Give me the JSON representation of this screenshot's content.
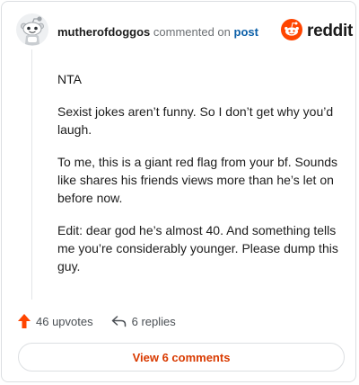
{
  "colors": {
    "reddit_orange": "#ff4500",
    "link_blue": "#0b5fa8",
    "button_text": "#d93a00"
  },
  "header": {
    "username": "mutherofdoggos",
    "action_text": "commented on",
    "post_link": "post",
    "logo_text": "reddit",
    "avatar_icon": "snoo-avatar-icon",
    "logo_icon": "reddit-alien-icon"
  },
  "comment": {
    "paragraphs": [
      "NTA",
      "Sexist jokes aren’t funny. So I don’t get why you’d laugh.",
      "To me, this is a giant red flag from your bf. Sounds like shares his friends views more than he’s let on before now.",
      "Edit: dear god he’s almost 40. And something tells me you’re considerably younger. Please dump this guy."
    ]
  },
  "actions": {
    "upvotes": "46 upvotes",
    "replies": "6 replies",
    "upvote_icon": "upvote-arrow-icon",
    "reply_icon": "reply-arrow-icon"
  },
  "footer": {
    "view_comments": "View 6 comments"
  }
}
